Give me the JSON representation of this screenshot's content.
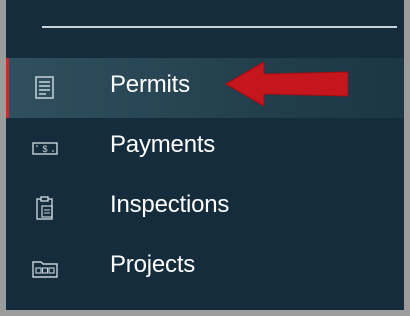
{
  "sidebar": {
    "items": [
      {
        "label": "Permits",
        "icon": "document-icon",
        "active": true
      },
      {
        "label": "Payments",
        "icon": "cash-icon",
        "active": false
      },
      {
        "label": "Inspections",
        "icon": "clipboard-icon",
        "active": false
      },
      {
        "label": "Projects",
        "icon": "folder-icon",
        "active": false
      }
    ]
  },
  "colors": {
    "panel_background": "#142c3b",
    "active_indicator": "#d4262d",
    "annotation_arrow": "#c4161c",
    "text": "#ffffff",
    "icon": "#c9d2d8"
  }
}
